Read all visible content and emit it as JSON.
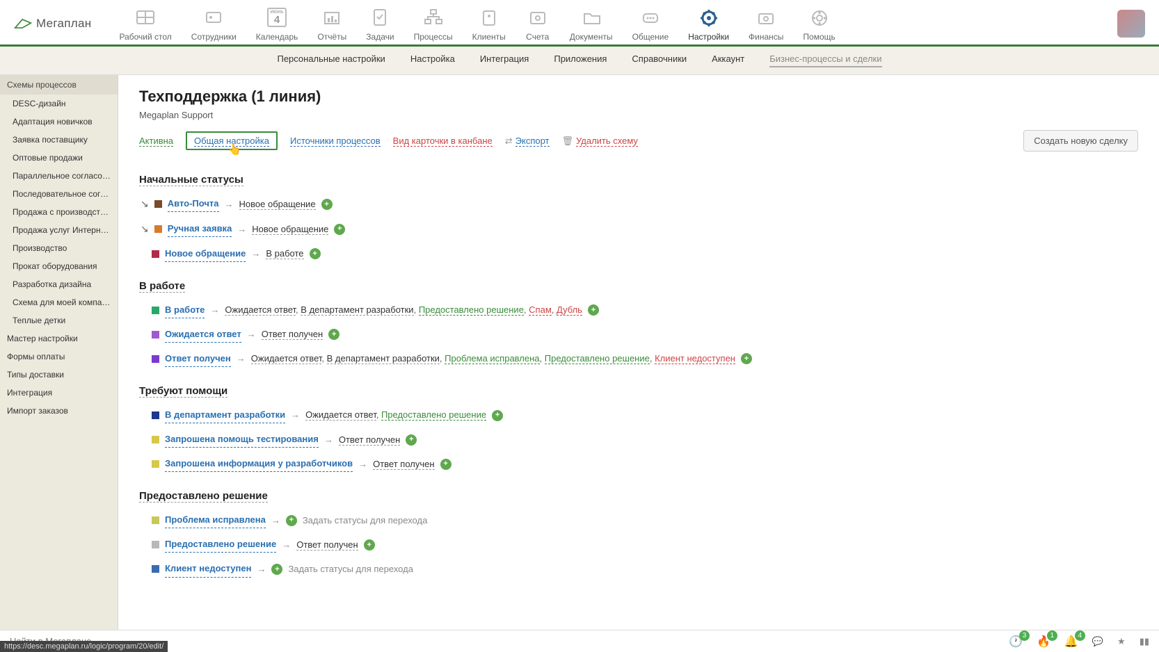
{
  "logo": "Мегаплан",
  "topnav": [
    {
      "label": "Рабочий стол"
    },
    {
      "label": "Сотрудники"
    },
    {
      "label": "Календарь",
      "sublabel": "июнь",
      "day": "4"
    },
    {
      "label": "Отчёты"
    },
    {
      "label": "Задачи"
    },
    {
      "label": "Процессы"
    },
    {
      "label": "Клиенты"
    },
    {
      "label": "Счета"
    },
    {
      "label": "Документы"
    },
    {
      "label": "Общение"
    },
    {
      "label": "Настройки",
      "active": true
    },
    {
      "label": "Финансы"
    },
    {
      "label": "Помощь"
    }
  ],
  "subnav": [
    {
      "label": "Персональные настройки"
    },
    {
      "label": "Настройка"
    },
    {
      "label": "Интеграция"
    },
    {
      "label": "Приложения"
    },
    {
      "label": "Справочники"
    },
    {
      "label": "Аккаунт"
    },
    {
      "label": "Бизнес-процессы и сделки",
      "active": true
    }
  ],
  "sidebar": {
    "section1_title": "Схемы процессов",
    "schemes": [
      "DESC-дизайн",
      "Адаптация новичков",
      "Заявка поставщику",
      "Оптовые продажи",
      "Параллельное согласование",
      "Последовательное согласов...",
      "Продажа с производством",
      "Продажа услуг Интернет-аге...",
      "Производство",
      "Прокат оборудования",
      "Разработка дизайна",
      "Схема для моей компании",
      "Теплые детки"
    ],
    "top_items": [
      "Мастер настройки",
      "Формы оплаты",
      "Типы доставки",
      "Интеграция",
      "Импорт заказов"
    ]
  },
  "page": {
    "title": "Техподдержка (1 линия)",
    "subtitle": "Megaplan Support",
    "actions": {
      "active": "Активна",
      "general": "Общая настройка",
      "sources": "Источники процессов",
      "kanban": "Вид карточки в канбане",
      "export": "Экспорт",
      "delete": "Удалить схему",
      "create": "Создать новую сделку"
    }
  },
  "sections": [
    {
      "title": "Начальные статусы",
      "rows": [
        {
          "start": true,
          "color": "#7a4a2a",
          "name": "Авто-Почта",
          "targets": [
            {
              "t": "Новое обращение"
            }
          ]
        },
        {
          "start": true,
          "color": "#d97a2a",
          "name": "Ручная заявка",
          "targets": [
            {
              "t": "Новое обращение"
            }
          ]
        },
        {
          "color": "#b02a4a",
          "name": "Новое обращение",
          "targets": [
            {
              "t": "В работе"
            }
          ]
        }
      ]
    },
    {
      "title": "В работе",
      "rows": [
        {
          "color": "#2aa86a",
          "name": "В работе",
          "targets": [
            {
              "t": "Ожидается ответ"
            },
            {
              "t": "В департамент разработки"
            },
            {
              "t": "Предоставлено решение",
              "c": "green"
            },
            {
              "t": "Спам",
              "c": "red"
            },
            {
              "t": "Дубль",
              "c": "red"
            }
          ]
        },
        {
          "color": "#a05ad0",
          "name": "Ожидается ответ",
          "targets": [
            {
              "t": "Ответ получен"
            }
          ]
        },
        {
          "color": "#7a3ad0",
          "name": "Ответ получен",
          "targets": [
            {
              "t": "Ожидается ответ"
            },
            {
              "t": "В департамент разработки"
            },
            {
              "t": "Проблема исправлена",
              "c": "green"
            },
            {
              "t": "Предоставлено решение",
              "c": "green"
            },
            {
              "t": "Клиент недоступен",
              "c": "red"
            }
          ]
        }
      ]
    },
    {
      "title": "Требуют помощи",
      "rows": [
        {
          "color": "#1a3a8a",
          "name": "В департамент разработки",
          "targets": [
            {
              "t": "Ожидается ответ"
            },
            {
              "t": "Предоставлено решение",
              "c": "green"
            }
          ]
        },
        {
          "color": "#d8c84a",
          "name": "Запрошена помощь тестирования",
          "targets": [
            {
              "t": "Ответ получен"
            }
          ]
        },
        {
          "color": "#d8c84a",
          "name": "Запрошена информация у разработчиков",
          "targets": [
            {
              "t": "Ответ получен"
            }
          ]
        }
      ]
    },
    {
      "title": "Предоставлено решение",
      "rows": [
        {
          "color": "#c8c85a",
          "name": "Проблема исправлена",
          "placeholder": "Задать статусы для перехода"
        },
        {
          "color": "#b8b8b8",
          "name": "Предоставлено решение",
          "targets": [
            {
              "t": "Ответ получен"
            }
          ]
        },
        {
          "color": "#3a6ab0",
          "name": "Клиент недоступен",
          "placeholder": "Задать статусы для перехода"
        }
      ]
    }
  ],
  "bottom": {
    "search_placeholder": "Найти в Мегаплане",
    "badges": {
      "clock": "3",
      "fire": "1",
      "bell": "4"
    }
  },
  "url_hint": "https://desc.megaplan.ru/logic/program/20/edit/"
}
